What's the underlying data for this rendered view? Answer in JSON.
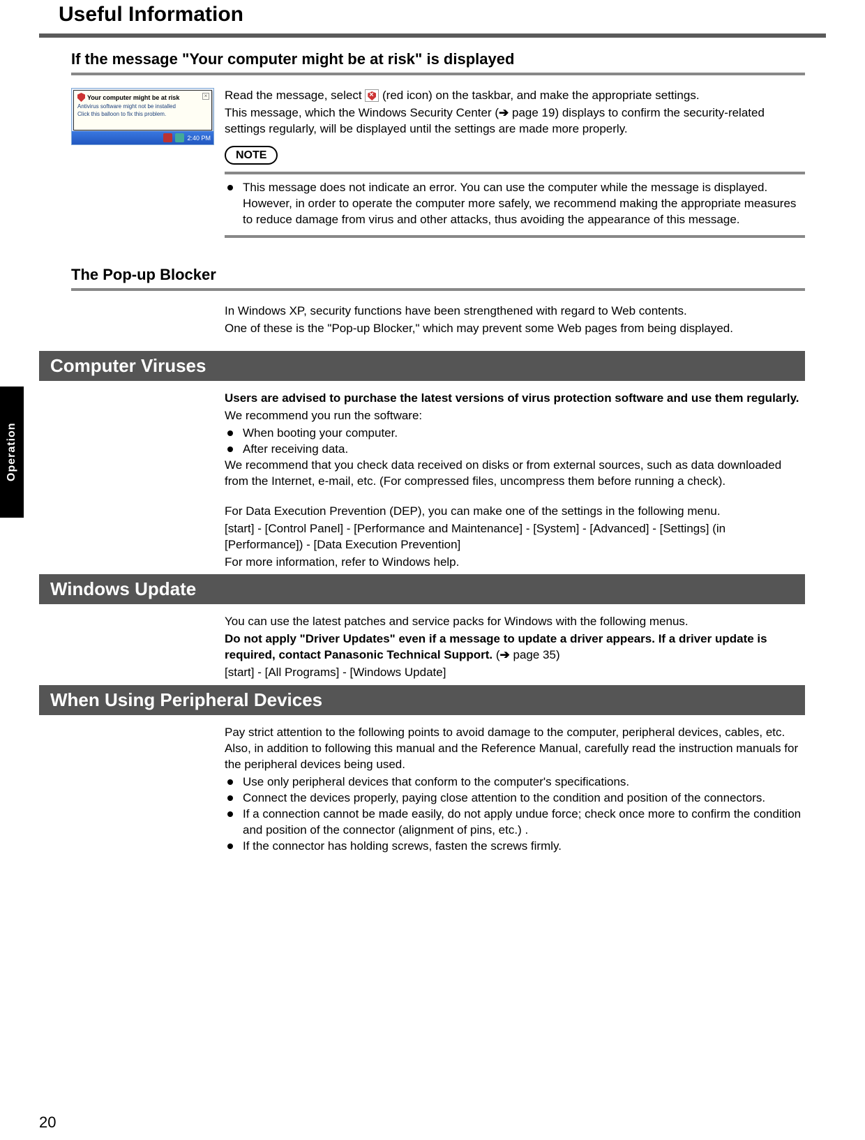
{
  "page": {
    "title": "Useful Information",
    "side_tab": "Operation",
    "number": "20"
  },
  "sections": {
    "risk": {
      "heading": "If the message \"Your computer might be at risk\" is displayed",
      "balloon": {
        "title": "Your computer might be at risk",
        "line1": "Antivirus software might not be installed",
        "line2": "Click this balloon to fix this problem.",
        "time": "2:40 PM"
      },
      "p1a": "Read the message, select ",
      "p1b": " (red icon) on the taskbar, and make the appropriate settings.",
      "p2a": "This message, which the Windows Security Center (",
      "p2_arrow": "➔",
      "p2b": " page 19) displays to confirm the security-related settings regularly, will be displayed until the settings are made more properly.",
      "note_label": "NOTE",
      "note_bullet": "This message does not indicate an error. You can use the computer while the message is displayed. However, in order to operate the computer more safely, we recommend making the appropriate measures to reduce damage from virus and other attacks, thus avoiding the appearance of this message."
    },
    "popup": {
      "heading": "The Pop-up Blocker",
      "p1": "In Windows XP, security functions have been strengthened with regard to Web contents.",
      "p2": "One of these is the \"Pop-up Blocker,\" which may prevent some Web pages from being displayed."
    },
    "viruses": {
      "heading": "Computer Viruses",
      "p1": "Users are advised to purchase the latest versions of virus protection software and use them regularly.",
      "p2": "We recommend you run the software:",
      "b1": "When booting your computer.",
      "b2": "After receiving data.",
      "p3": "We recommend that you check data received on disks or from external sources, such as data downloaded from the Internet, e-mail, etc.  (For compressed files, uncompress them before running a check).",
      "p4": "For Data Execution Prevention (DEP), you can make one of the settings in the following menu.",
      "p5": "[start] - [Control Panel] - [Performance and Maintenance] - [System] - [Advanced] - [Settings] (in [Performance]) - [Data Execution Prevention]",
      "p6": "For more information, refer to Windows help."
    },
    "update": {
      "heading": "Windows Update",
      "p1": "You can use the latest patches and service packs for Windows with the following menus.",
      "p2a": "Do not apply \"Driver Updates\" even if a message to update a driver appears. If a driver update is required, contact Panasonic Technical Support.",
      "p2_arrow": "➔",
      "p2b": " page 35)",
      "p3": "[start] - [All Programs] - [Windows Update]"
    },
    "peripherals": {
      "heading": "When Using Peripheral Devices",
      "p1": "Pay strict attention to the following points to avoid damage to the computer, peripheral devices, cables, etc.  Also, in addition to following this manual and the Reference Manual, carefully read the instruction manuals for the peripheral devices being used.",
      "b1": "Use only peripheral devices that conform to the computer's specifications.",
      "b2": "Connect the devices properly, paying close attention to the condition and position of the connectors.",
      "b3": "If a connection cannot be made easily, do not apply undue force; check once more to confirm the condition and position of the connector (alignment of pins, etc.) .",
      "b4": "If the connector has holding screws, fasten the screws firmly."
    }
  }
}
